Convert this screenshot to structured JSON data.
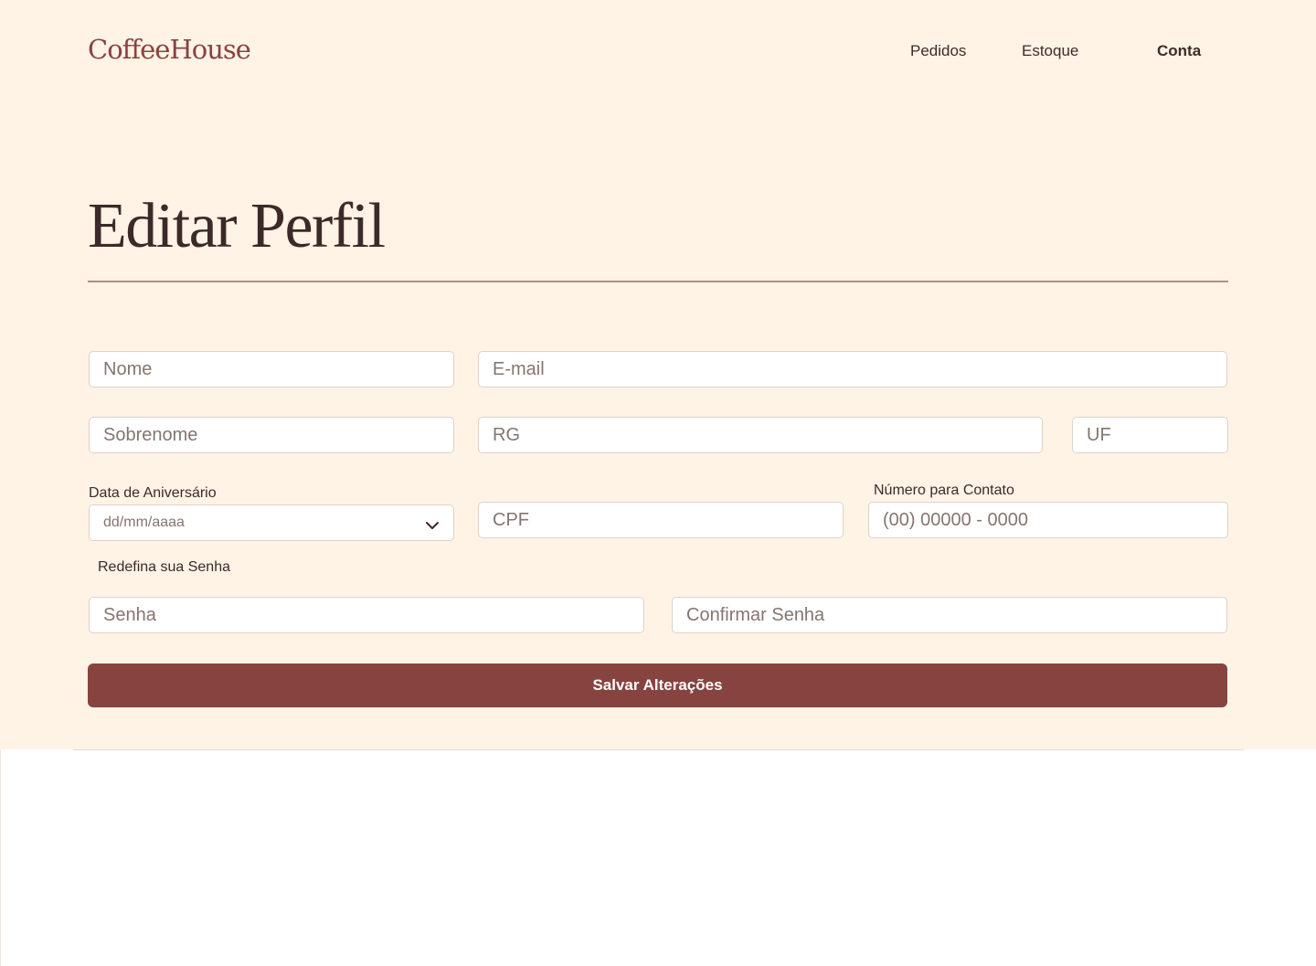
{
  "header": {
    "logo": "CoffeeHouse",
    "nav": [
      {
        "label": "Pedidos"
      },
      {
        "label": "Estoque"
      },
      {
        "label": "Conta"
      }
    ]
  },
  "page": {
    "title": "Editar Perfil"
  },
  "form": {
    "nome_placeholder": "Nome",
    "email_placeholder": "E-mail",
    "sobrenome_placeholder": "Sobrenome",
    "rg_placeholder": "RG",
    "uf_placeholder": "UF",
    "birthday_label": "Data de Aniversário",
    "birthday_value": "dd/mm/aaaa",
    "cpf_placeholder": "CPF",
    "phone_label": "Número para Contato",
    "phone_placeholder": "(00) 00000 - 0000",
    "password_section_label": "Redefina sua Senha",
    "senha_placeholder": "Senha",
    "confirmar_senha_placeholder": "Confirmar Senha",
    "save_label": "Salvar Alterações"
  },
  "colors": {
    "background": "#fff3e6",
    "brand": "#8a4340",
    "button": "#874340",
    "text": "#3b2a29"
  },
  "icons": {
    "birthday_dropdown": "chevron-down-icon"
  }
}
